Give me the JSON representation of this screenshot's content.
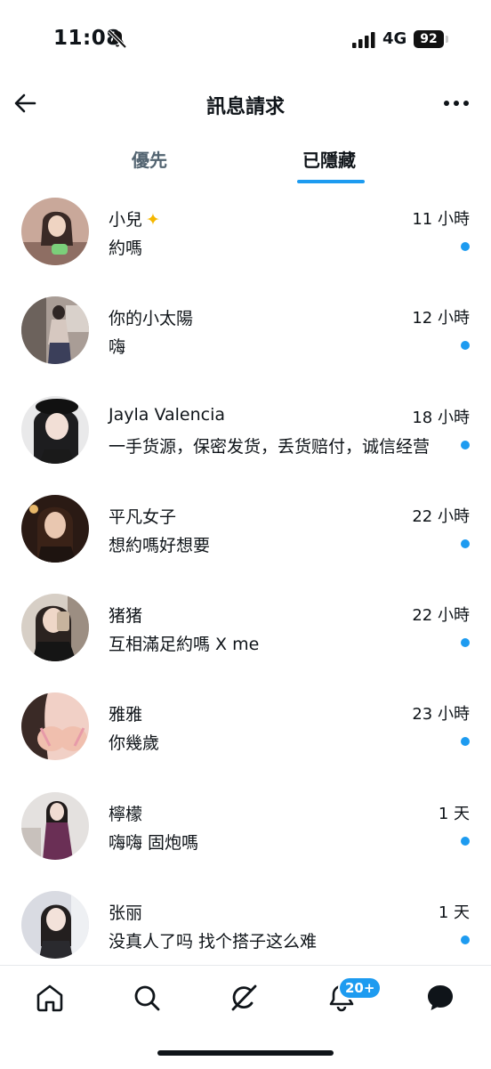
{
  "status_bar": {
    "time": "11:08",
    "network": "4G",
    "battery": "92"
  },
  "header": {
    "title": "訊息請求"
  },
  "tabs": [
    {
      "label": "優先",
      "active": false
    },
    {
      "label": "已隱藏",
      "active": true
    }
  ],
  "messages": [
    {
      "name": "小兒",
      "emoji": "💫",
      "time": "11 小時",
      "preview": "約嗎",
      "unread": true
    },
    {
      "name": "你的小太陽",
      "emoji": "",
      "time": "12 小時",
      "preview": "嗨",
      "unread": true
    },
    {
      "name": "Jayla Valencia",
      "emoji": "",
      "time": "18 小時",
      "preview": "一手货源，保密发货，丢货赔付，诚信经营",
      "unread": true
    },
    {
      "name": "平凡女子",
      "emoji": "",
      "time": "22 小時",
      "preview": "想約嗎好想要",
      "unread": true
    },
    {
      "name": "猪猪",
      "emoji": "",
      "time": "22 小時",
      "preview": "互相滿足約嗎 X me",
      "unread": true
    },
    {
      "name": "雅雅",
      "emoji": "",
      "time": "23 小時",
      "preview": "你幾歲",
      "unread": true
    },
    {
      "name": "檸檬",
      "emoji": "",
      "time": "1 天",
      "preview": "嗨嗨 固炮嗎",
      "unread": true
    },
    {
      "name": "张丽",
      "emoji": "",
      "time": "1 天",
      "preview": "没真人了吗 找个搭子这么难",
      "unread": true
    }
  ],
  "bottom_nav": {
    "items": [
      "home-icon",
      "search-icon",
      "grok-icon",
      "bell-icon",
      "messages-icon"
    ],
    "notification_badge": "20+"
  },
  "colors": {
    "accent": "#1d9bf0",
    "text": "#0f1419",
    "muted": "#536471"
  }
}
